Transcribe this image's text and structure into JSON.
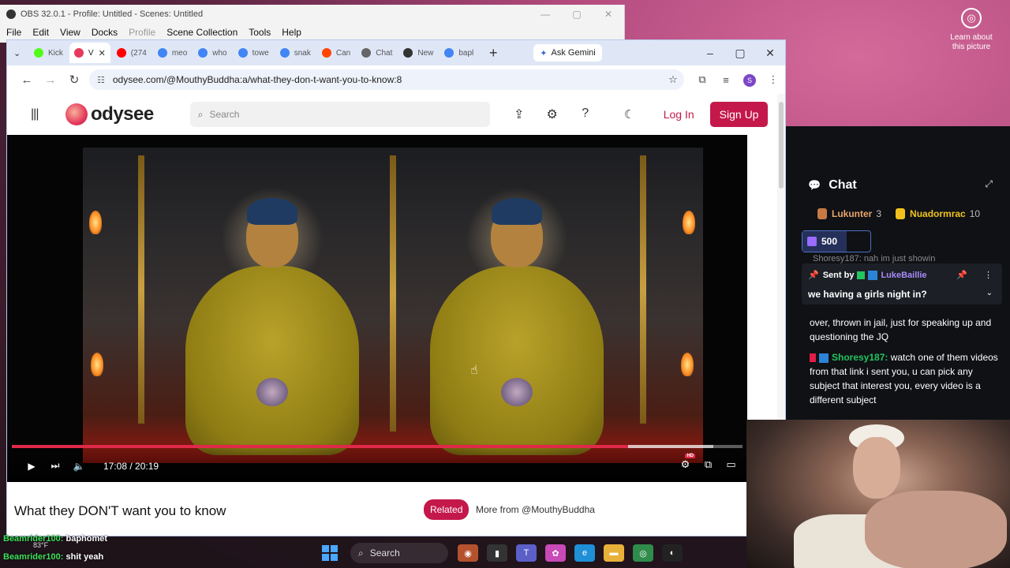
{
  "desktop": {
    "learn_about": "Learn about this picture"
  },
  "obs": {
    "title": "OBS 32.0.1 - Profile: Untitled - Scenes: Untitled",
    "menu": [
      "File",
      "Edit",
      "View",
      "Docks",
      "Profile",
      "Scene Collection",
      "Tools",
      "Help"
    ]
  },
  "browser": {
    "tabs": [
      {
        "label": "Kick",
        "color": "#53fc18"
      },
      {
        "label": "V",
        "color": "#e53a5c",
        "active": true
      },
      {
        "label": "(274",
        "color": "#ff0000"
      },
      {
        "label": "meo",
        "color": "#4285f4"
      },
      {
        "label": "who",
        "color": "#4285f4"
      },
      {
        "label": "towe",
        "color": "#4285f4"
      },
      {
        "label": "snak",
        "color": "#4285f4"
      },
      {
        "label": "Can",
        "color": "#ff4500"
      },
      {
        "label": "Chat",
        "color": "#666666"
      },
      {
        "label": "New",
        "color": "#333333"
      },
      {
        "label": "bapl",
        "color": "#4285f4"
      }
    ],
    "gemini_label": "Ask Gemini",
    "url": "odysee.com/@MouthyBuddha:a/what-they-don-t-want-you-to-know:8",
    "profile_initial": "S"
  },
  "odysee": {
    "logo_text": "odysee",
    "search_placeholder": "Search",
    "login_label": "Log In",
    "signup_label": "Sign Up",
    "video": {
      "time": "17:08 / 20:19",
      "progress_fraction": 0.843,
      "buffered_fraction": 0.96
    },
    "video_title": "What they DON'T want you to know",
    "related_label": "Related",
    "more_from_label": "More from @MouthyBuddha"
  },
  "chat": {
    "title": "Chat",
    "leaders": [
      {
        "name": "Lukunter",
        "count": "3"
      },
      {
        "name": "Nuadormrac",
        "count": "10"
      }
    ],
    "kicks_amount": "500",
    "cut_message": "Shoresy187: nah im just showin",
    "pinned": {
      "sent_by": "Sent by",
      "user": "LukeBaillie",
      "text": "we having a girls night in?"
    },
    "messages": [
      {
        "user": "",
        "text": "over, thrown in jail, just for speaking up and questioning the JQ"
      },
      {
        "user": "Shoresy187:",
        "text": "watch one of them videos from that link i sent you, u can pick any subject that interest you, every video is a different subject"
      }
    ]
  },
  "overlay_chat": [
    {
      "user": "Beamrider100:",
      "text": "baphomet"
    },
    {
      "user": "Beamrider100:",
      "text": "shit yeah"
    }
  ],
  "taskbar": {
    "search_label": "Search",
    "weather": "83°F"
  }
}
